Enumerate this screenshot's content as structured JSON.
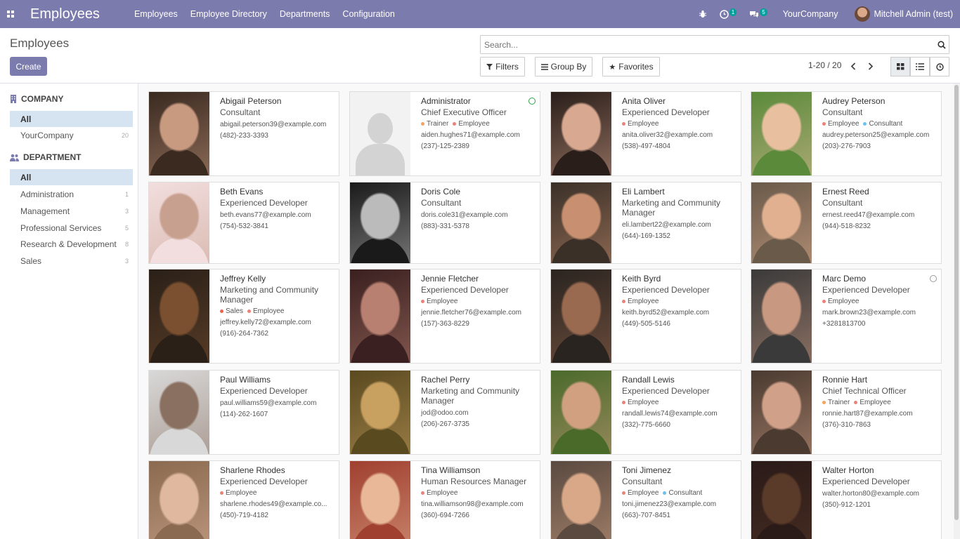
{
  "navbar": {
    "app_title": "Employees",
    "menu": [
      "Employees",
      "Employee Directory",
      "Departments",
      "Configuration"
    ],
    "activity_count": "1",
    "message_count": "5",
    "company": "YourCompany",
    "user": "Mitchell Admin (test)"
  },
  "control_panel": {
    "breadcrumb": "Employees",
    "create_label": "Create",
    "search_placeholder": "Search...",
    "filters_label": "Filters",
    "group_by_label": "Group By",
    "favorites_label": "Favorites",
    "pager": "1-20 / 20"
  },
  "sidebar": {
    "company_header": "COMPANY",
    "company_items": [
      {
        "label": "All",
        "count": ""
      },
      {
        "label": "YourCompany",
        "count": "20"
      }
    ],
    "department_header": "DEPARTMENT",
    "department_items": [
      {
        "label": "All",
        "count": ""
      },
      {
        "label": "Administration",
        "count": "1"
      },
      {
        "label": "Management",
        "count": "3"
      },
      {
        "label": "Professional Services",
        "count": "5"
      },
      {
        "label": "Research & Development",
        "count": "8"
      },
      {
        "label": "Sales",
        "count": "3"
      }
    ]
  },
  "colors": {
    "brand": "#7c7bad",
    "tag_employee": "#e9837a",
    "tag_consultant": "#6cc1ed",
    "tag_trainer": "#f4a460",
    "tag_sales": "#f06050",
    "presence_online": "#28a745"
  },
  "employees": [
    {
      "name": "Abigail Peterson",
      "job": "Consultant",
      "job2": "",
      "tags": [],
      "email": "abigail.peterson39@example.com",
      "phone": "(482)-233-3393",
      "photo": [
        "#3a2a20",
        "#c89a80"
      ]
    },
    {
      "name": "Administrator",
      "job": "Chief Executive Officer",
      "job2": "",
      "tags": [
        "Trainer",
        "Employee"
      ],
      "email": "aiden.hughes71@example.com",
      "phone": "(237)-125-2389",
      "photo": null
    },
    {
      "name": "Anita Oliver",
      "job": "Experienced Developer",
      "job2": "",
      "tags": [
        "Employee"
      ],
      "email": "anita.oliver32@example.com",
      "phone": "(538)-497-4804",
      "photo": [
        "#2a1e1a",
        "#d8a890"
      ]
    },
    {
      "name": "Audrey Peterson",
      "job": "Consultant",
      "job2": "",
      "tags": [
        "Employee",
        "Consultant"
      ],
      "email": "audrey.peterson25@example.com",
      "phone": "(203)-276-7903",
      "photo": [
        "#5a8a3a",
        "#e8c0a0"
      ]
    },
    {
      "name": "Beth Evans",
      "job": "Experienced Developer",
      "job2": "",
      "tags": [],
      "email": "beth.evans77@example.com",
      "phone": "(754)-532-3841",
      "photo": [
        "#f2dede",
        "#c8a090"
      ]
    },
    {
      "name": "Doris Cole",
      "job": "Consultant",
      "job2": "",
      "tags": [],
      "email": "doris.cole31@example.com",
      "phone": "(883)-331-5378",
      "photo": [
        "#1a1a1a",
        "#bbbbbb"
      ]
    },
    {
      "name": "Eli Lambert",
      "job": "Marketing and Community",
      "job2": "Manager",
      "tags": [],
      "email": "eli.lambert22@example.com",
      "phone": "(644)-169-1352",
      "photo": [
        "#3a3028",
        "#c89070"
      ]
    },
    {
      "name": "Ernest Reed",
      "job": "Consultant",
      "job2": "",
      "tags": [],
      "email": "ernest.reed47@example.com",
      "phone": "(944)-518-8232",
      "photo": [
        "#6a5a4a",
        "#e0b090"
      ]
    },
    {
      "name": "Jeffrey Kelly",
      "job": "Marketing and Community",
      "job2": "Manager",
      "tags": [
        "Sales",
        "Employee"
      ],
      "email": "jeffrey.kelly72@example.com",
      "phone": "(916)-264-7362",
      "photo": [
        "#2a2018",
        "#7a5030"
      ]
    },
    {
      "name": "Jennie Fletcher",
      "job": "Experienced Developer",
      "job2": "",
      "tags": [
        "Employee"
      ],
      "email": "jennie.fletcher76@example.com",
      "phone": "(157)-363-8229",
      "photo": [
        "#3a2020",
        "#b88070"
      ]
    },
    {
      "name": "Keith Byrd",
      "job": "Experienced Developer",
      "job2": "",
      "tags": [
        "Employee"
      ],
      "email": "keith.byrd52@example.com",
      "phone": "(449)-505-5146",
      "photo": [
        "#2a2420",
        "#9a6a50"
      ]
    },
    {
      "name": "Marc Demo",
      "job": "Experienced Developer",
      "job2": "",
      "tags": [
        "Employee"
      ],
      "email": "mark.brown23@example.com",
      "phone": "+3281813700",
      "photo": [
        "#3a3a3a",
        "#c89880"
      ]
    },
    {
      "name": "Paul Williams",
      "job": "Experienced Developer",
      "job2": "",
      "tags": [],
      "email": "paul.williams59@example.com",
      "phone": "(114)-262-1607",
      "photo": [
        "#d8d8d8",
        "#8a7060"
      ]
    },
    {
      "name": "Rachel Perry",
      "job": "Marketing and Community",
      "job2": "Manager",
      "tags": [],
      "email": "jod@odoo.com",
      "phone": "(206)-267-3735",
      "photo": [
        "#5a4a20",
        "#c8a060"
      ]
    },
    {
      "name": "Randall Lewis",
      "job": "Experienced Developer",
      "job2": "",
      "tags": [
        "Employee"
      ],
      "email": "randall.lewis74@example.com",
      "phone": "(332)-775-6660",
      "photo": [
        "#4a6a2a",
        "#d0a080"
      ]
    },
    {
      "name": "Ronnie Hart",
      "job": "Chief Technical Officer",
      "job2": "",
      "tags": [
        "Trainer",
        "Employee"
      ],
      "email": "ronnie.hart87@example.com",
      "phone": "(376)-310-7863",
      "photo": [
        "#4a3a30",
        "#d0a088"
      ]
    },
    {
      "name": "Sharlene Rhodes",
      "job": "Experienced Developer",
      "job2": "",
      "tags": [
        "Employee"
      ],
      "email": "sharlene.rhodes49@example.co...",
      "phone": "(450)-719-4182",
      "photo": [
        "#8a6a50",
        "#e0b8a0"
      ]
    },
    {
      "name": "Tina Williamson",
      "job": "Human Resources Manager",
      "job2": "",
      "tags": [
        "Employee"
      ],
      "email": "tina.williamson98@example.com",
      "phone": "(360)-694-7266",
      "photo": [
        "#a04030",
        "#e8b898"
      ]
    },
    {
      "name": "Toni Jimenez",
      "job": "Consultant",
      "job2": "",
      "tags": [
        "Employee",
        "Consultant"
      ],
      "email": "toni.jimenez23@example.com",
      "phone": "(663)-707-8451",
      "photo": [
        "#5a4a40",
        "#d8a888"
      ]
    },
    {
      "name": "Walter Horton",
      "job": "Experienced Developer",
      "job2": "",
      "tags": [],
      "email": "walter.horton80@example.com",
      "phone": "(350)-912-1201",
      "photo": [
        "#2a1a18",
        "#5a3a28"
      ]
    }
  ]
}
